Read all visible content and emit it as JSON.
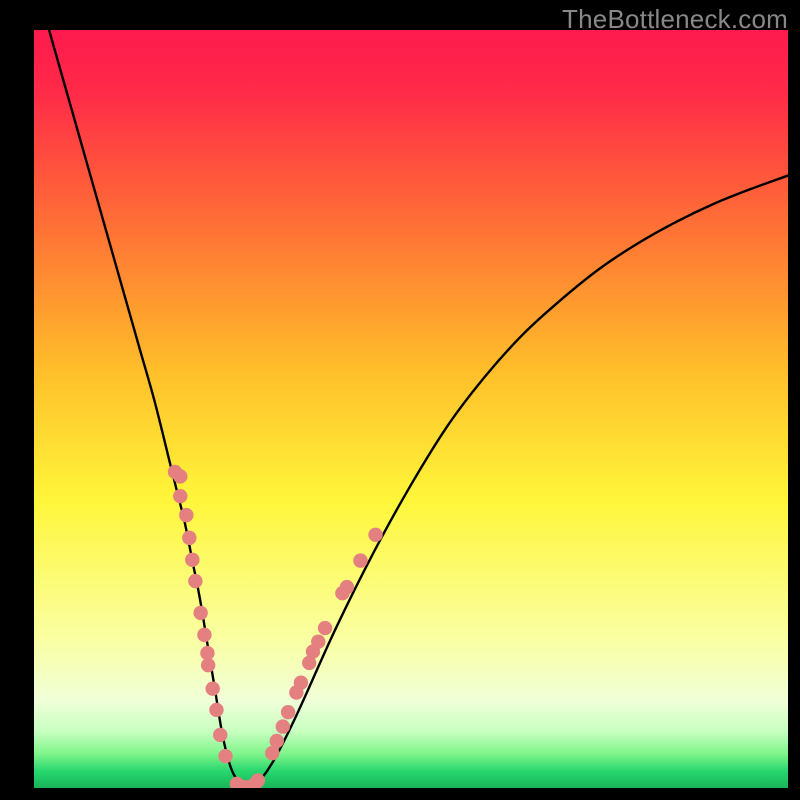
{
  "watermark": "TheBottleneck.com",
  "colors": {
    "bg_black": "#000000",
    "curve": "#000000",
    "dots": "#e48080",
    "grad_top": "#fe1a4e",
    "grad_mid_upper": "#ff7b35",
    "grad_mid": "#ffd127",
    "grad_mid_lower": "#fbff3d",
    "grad_low": "#f3ffb4",
    "grad_green_light": "#8fff8f",
    "grad_green": "#1fd86e",
    "grad_green_dark": "#19b85a"
  },
  "chart_data": {
    "type": "line",
    "title": "",
    "xlabel": "",
    "ylabel": "",
    "xlim": [
      0,
      100
    ],
    "ylim": [
      0,
      100
    ],
    "series": [
      {
        "name": "bottleneck-curve",
        "x": [
          2,
          4,
          6,
          8,
          10,
          12,
          14,
          16,
          18,
          19,
          20,
          21,
          22,
          23,
          24,
          25,
          26,
          27,
          28,
          29,
          30,
          32,
          35,
          40,
          45,
          50,
          55,
          60,
          65,
          70,
          75,
          80,
          85,
          90,
          95,
          100
        ],
        "y": [
          100,
          93,
          86,
          79,
          72,
          65,
          58,
          51,
          43,
          39,
          35,
          30,
          25,
          19,
          13,
          7,
          3,
          1,
          0.2,
          0.2,
          1,
          4,
          10,
          21,
          31,
          40,
          48,
          54.5,
          60,
          64.5,
          68.5,
          71.8,
          74.6,
          77,
          79,
          80.8
        ]
      }
    ],
    "flat_bottom": {
      "x_start": 26.8,
      "x_end": 29.4,
      "y": 0.1
    },
    "dot_clusters": [
      {
        "name": "left-cluster",
        "points": [
          [
            19.4,
            38.5
          ],
          [
            18.7,
            41.7
          ],
          [
            19.4,
            41.1
          ],
          [
            20.2,
            36
          ],
          [
            20.6,
            33
          ],
          [
            21.0,
            30.1
          ],
          [
            21.4,
            27.3
          ],
          [
            22.1,
            23.1
          ],
          [
            22.6,
            20.2
          ],
          [
            23.1,
            16.2
          ],
          [
            23.0,
            17.8
          ],
          [
            23.7,
            13.1
          ],
          [
            24.2,
            10.3
          ],
          [
            24.7,
            7.0
          ],
          [
            25.4,
            4.2
          ]
        ]
      },
      {
        "name": "bottom-cluster",
        "points": [
          [
            26.9,
            0.55
          ],
          [
            27.6,
            0.15
          ],
          [
            28.5,
            0.1
          ],
          [
            29.1,
            0.35
          ],
          [
            29.7,
            1.0
          ]
        ]
      },
      {
        "name": "right-cluster",
        "points": [
          [
            31.6,
            4.6
          ],
          [
            32.2,
            6.2
          ],
          [
            33.0,
            8.1
          ],
          [
            33.7,
            10.0
          ],
          [
            34.8,
            12.6
          ],
          [
            35.4,
            13.9
          ],
          [
            36.5,
            16.5
          ],
          [
            37.0,
            18.0
          ],
          [
            37.7,
            19.3
          ],
          [
            38.6,
            21.1
          ],
          [
            40.9,
            25.7
          ],
          [
            41.5,
            26.5
          ],
          [
            43.3,
            30.0
          ],
          [
            45.3,
            33.4
          ]
        ]
      }
    ]
  }
}
